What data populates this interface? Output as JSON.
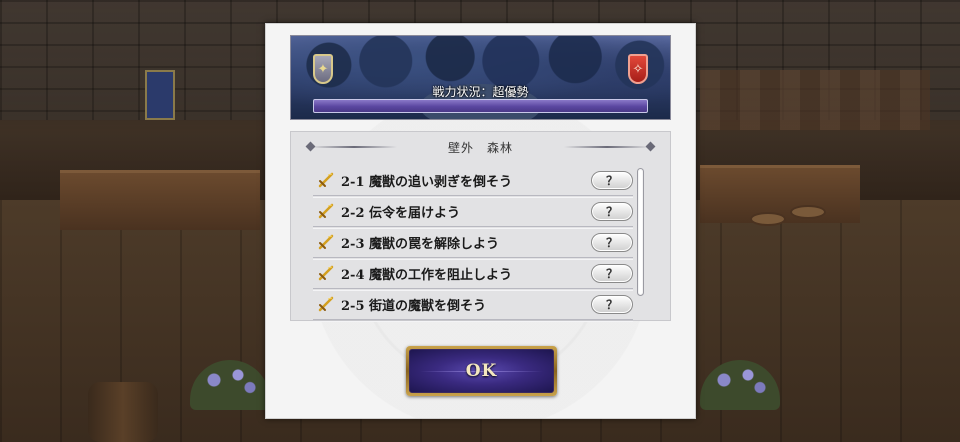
{
  "dialog": {
    "battle_status": "戦力状況：超優勢",
    "area_title": "壁外　森林",
    "quests": [
      {
        "label": "2-1 魔獣の追い剥ぎを倒そう",
        "button": "？"
      },
      {
        "label": "2-2 伝令を届けよう",
        "button": "？"
      },
      {
        "label": "2-3 魔獣の罠を解除しよう",
        "button": "？"
      },
      {
        "label": "2-4 魔獣の工作を阻止しよう",
        "button": "？"
      },
      {
        "label": "2-5 街道の魔獣を倒そう",
        "button": "？"
      }
    ],
    "ok_label": "OK"
  },
  "colors": {
    "ally_emblem": "#8a8aa0",
    "enemy_emblem": "#d8382c",
    "battle_bar": "#6a58b0",
    "ok_gold": "#c9a24a"
  },
  "icons": {
    "quest": "sword-icon",
    "ally": "ally-emblem-icon",
    "enemy": "enemy-emblem-icon"
  }
}
